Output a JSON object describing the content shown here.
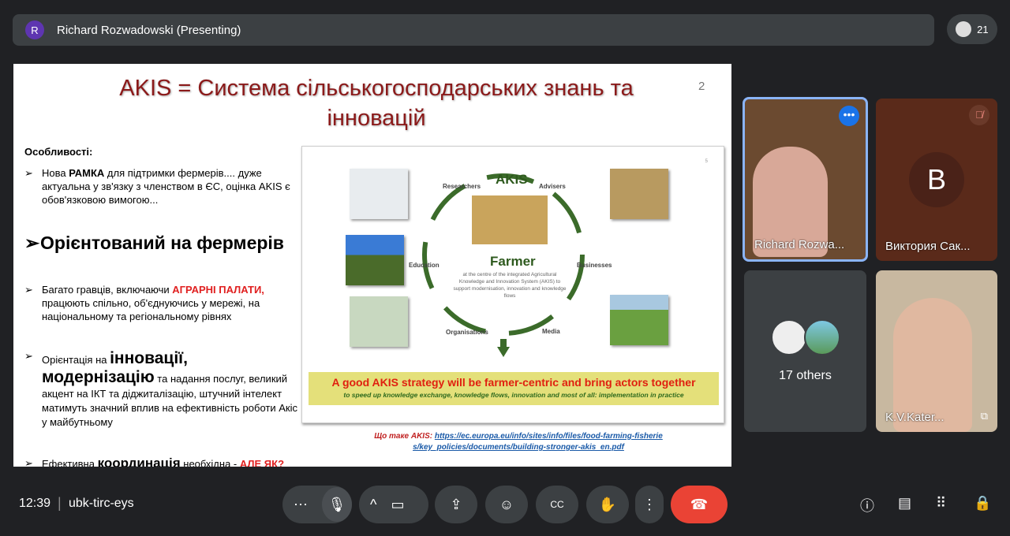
{
  "topbar": {
    "avatar_letter": "R",
    "presenting": "Richard Rozwadowski (Presenting)",
    "participant_count": "21"
  },
  "slide": {
    "title": "AKIS = Система сільськогосподарських знань та інновацій",
    "page_number": "2",
    "features_heading": "Особливості:",
    "b1": {
      "a": "Нова ",
      "b": "РАМКА",
      "c": " для підтримки фермерів.... дуже актуальна у зв'язку з членством в ЄС, оцінка AKIS є обов'язковою вимогою..."
    },
    "b2": "Орієнтований на фермерів",
    "b3": {
      "a": "Багато гравців, включаючи ",
      "b": "АГРАРНІ ПАЛАТИ,",
      "c": " працюють спільно, об'єднуючись у мережі, на національному та регіональному рівнях"
    },
    "b4": {
      "a": "Орієнтація на ",
      "b": "інновації, модернізацію",
      "c": " та надання послуг, великий акцент на ІКТ та діджиталізацію, штучний інтелект матимуть значний вплив на ефективність роботи Акіс у майбутньому"
    },
    "b5": {
      "a": "Ефективна ",
      "b": "координація",
      "c": " необхідна - ",
      "d": "АЛЕ ЯК?"
    },
    "diagram": {
      "page": "5",
      "center": "AKIS",
      "farmer": "Farmer",
      "farmer_desc": "at the centre of the integrated Agricultural Knowledge and Innovation System (AKIS) to support modernisation, innovation and knowledge flows",
      "labels": [
        "Researchers",
        "Advisers",
        "Education",
        "Businesses",
        "Organisations",
        "Media"
      ],
      "banner_title": "A good AKIS strategy will be farmer-centric and bring actors together",
      "banner_sub": "to speed up knowledge exchange, knowledge flows, innovation and most of all: implementation in practice"
    },
    "link_label": "Що таке AKIS:",
    "link_url": "https://ec.europa.eu/info/sites/info/files/food-farming-fisheries/key_policies/documents/building-stronger-akis_en.pdf"
  },
  "tiles": {
    "t1": "Richard Rozwa...",
    "t2_letter": "B",
    "t2": "Виктория Сак...",
    "t3": "17 others",
    "t4": "K.V.Kater..."
  },
  "bottom": {
    "time": "12:39",
    "meeting_code": "ubk-tirc-eys"
  },
  "colors": {
    "end_call": "#ea4335",
    "active_tile": "#8ab4f8",
    "bg": "#202124"
  }
}
